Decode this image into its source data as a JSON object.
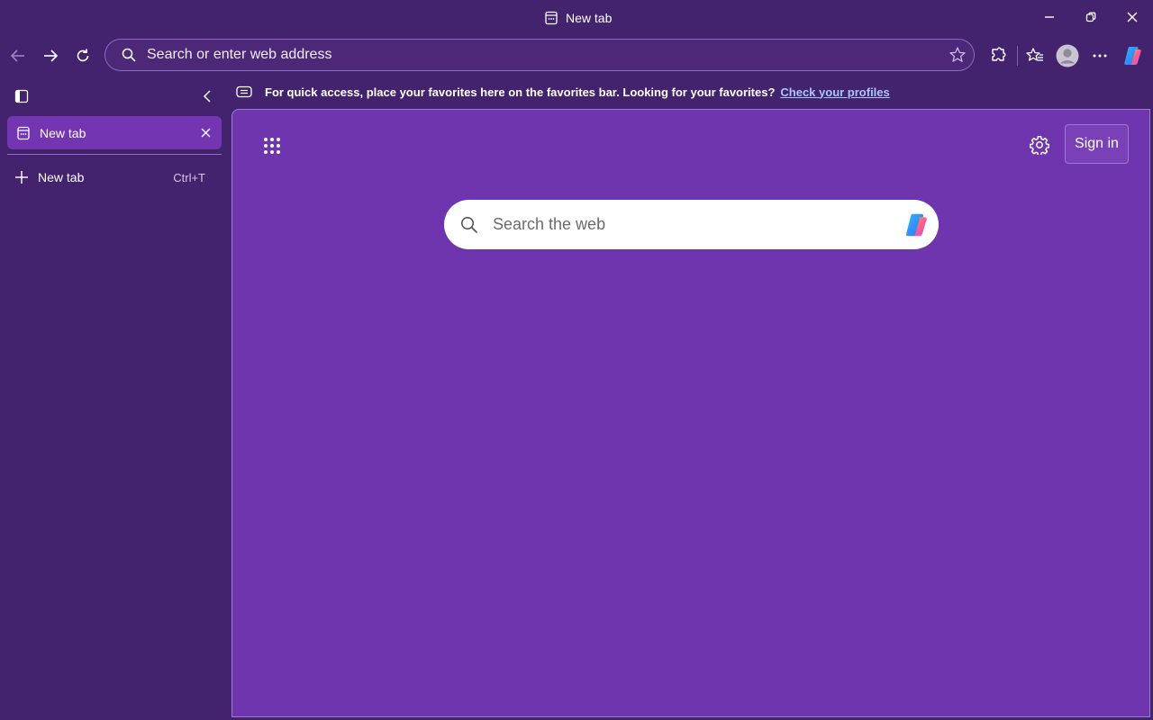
{
  "window": {
    "title": "New tab",
    "controls": [
      "minimize",
      "restore",
      "close"
    ]
  },
  "toolbar": {
    "address_placeholder": "Search or enter web address",
    "nav_icons": [
      "back-icon",
      "forward-icon",
      "refresh-icon"
    ],
    "right_icons": [
      "extensions-icon",
      "favorites-icon",
      "profile-avatar",
      "more-icon",
      "copilot-icon"
    ]
  },
  "favorites_bar": {
    "message": "For quick access, place your favorites here on the favorites bar. Looking for your favorites?",
    "link": "Check your profiles"
  },
  "sidebar": {
    "tabs": [
      {
        "label": "New tab",
        "active": true
      }
    ],
    "new_tab": {
      "label": "New tab",
      "shortcut": "Ctrl+T"
    }
  },
  "newtab_page": {
    "sign_in_label": "Sign in",
    "search_placeholder": "Search the web"
  },
  "colors": {
    "window_bg": "#43226e",
    "content_bg": "#6f35ae",
    "active_tab": "#7335b2",
    "link": "#a8c6ff"
  }
}
